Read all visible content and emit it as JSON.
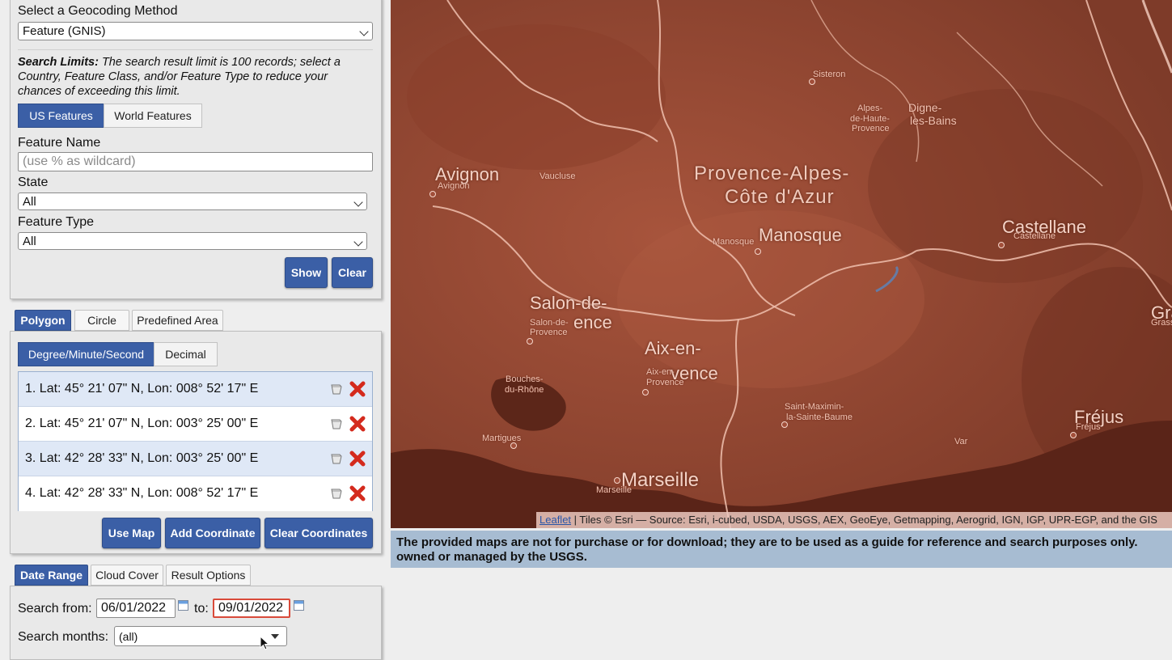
{
  "geocoding": {
    "label": "Select a Geocoding Method",
    "selected": "Feature (GNIS)",
    "limits_bold": "Search Limits:",
    "limits_text": "The search result limit is 100 records; select a Country, Feature Class, and/or Feature Type to reduce your chances of exceeding this limit.",
    "tabs": [
      "US Features",
      "World Features"
    ],
    "feature_name_label": "Feature Name",
    "feature_name_placeholder": "(use % as wildcard)",
    "state_label": "State",
    "state_value": "All",
    "feature_type_label": "Feature Type",
    "feature_type_value": "All",
    "show_label": "Show",
    "clear_label": "Clear"
  },
  "area": {
    "tabs": [
      "Polygon",
      "Circle",
      "Predefined Area"
    ],
    "format_tabs": [
      "Degree/Minute/Second",
      "Decimal"
    ],
    "coordinates": [
      "1.  Lat: 45° 21' 07\" N, Lon: 008° 52' 17\" E",
      "2.  Lat: 45° 21' 07\" N, Lon: 003° 25' 00\" E",
      "3.  Lat: 42° 28' 33\" N, Lon: 003° 25' 00\" E",
      "4.  Lat: 42° 28' 33\" N, Lon: 008° 52' 17\" E"
    ],
    "use_map": "Use Map",
    "add_coordinate": "Add Coordinate",
    "clear_coordinates": "Clear Coordinates"
  },
  "date": {
    "tabs": [
      "Date Range",
      "Cloud Cover",
      "Result Options"
    ],
    "search_from_label": "Search from:",
    "from_value": "06/01/2022",
    "to_label": "to:",
    "to_value": "09/01/2022",
    "months_label": "Search months:",
    "months_value": "(all)"
  },
  "map": {
    "labels_big": [
      "Provence-Alpes-",
      "Côte d'Azur"
    ],
    "cities": {
      "avignon": "Avignon",
      "manosque": "Manosque",
      "salon": "Salon-de-",
      "salon2": "ence",
      "aix": "Aix-en-",
      "aix2": "vence",
      "marseille": "Marseille",
      "castellane": "Castellane",
      "frejus": "Fréjus",
      "gra": "Gra"
    },
    "small": {
      "sisteron": "Sisteron",
      "alpes1": "Alpes-",
      "alpes2": "de-Haute-",
      "alpes3": "Provence",
      "digne1": "Digne-",
      "digne2": "les-Bains",
      "avignon_s": "Avignon",
      "vaucluse": "Vaucluse",
      "manosque_s": "Manosque",
      "castellane_s": "Castellane",
      "salon_s1": "Salon-de-",
      "salon_s2": "Provence",
      "aix_s1": "Aix-en-",
      "aix_s2": "Provence",
      "bouches1": "Bouches-",
      "bouches2": "du-Rhône",
      "stmax1": "Saint-Maximin-",
      "stmax2": "la-Sainte-Baume",
      "martigues": "Martigues",
      "var": "Var",
      "marseille_s": "Marseille",
      "frejus_s": "Fréjus",
      "grasse": "Grasse"
    },
    "attribution_link": "Leaflet",
    "attribution_text": "| Tiles © Esri — Source: Esri, i-cubed, USDA, USGS, AEX, GeoEye, Getmapping, Aerogrid, IGN, IGP, UPR-EGP, and the GIS",
    "notice": "The provided maps are not for purchase or for download; they are to be used as a guide for reference and search purposes only. owned or managed by the USGS."
  }
}
